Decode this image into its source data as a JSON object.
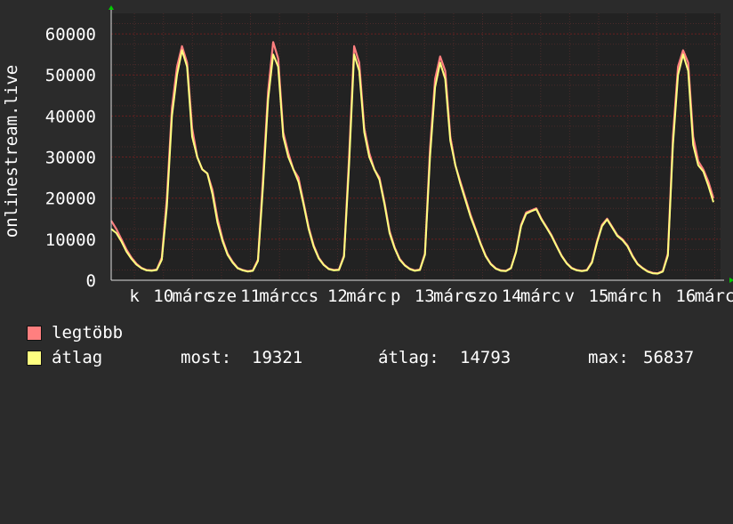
{
  "chart_data": {
    "type": "area",
    "ylabel": "onlinestream.live",
    "y_ticks": [
      "0",
      "10000",
      "20000",
      "30000",
      "40000",
      "50000",
      "60000"
    ],
    "ylim": [
      0,
      65000
    ],
    "x_tick_labels": [
      "k",
      "10",
      "márc",
      "sze",
      "11",
      "márc",
      "cs",
      "12",
      "márc",
      "p",
      "13",
      "márc",
      "szo",
      "14",
      "márc",
      "v",
      "15",
      "márc",
      "h",
      "16",
      "márc"
    ],
    "grid": true,
    "series": [
      {
        "name": "legtöbb",
        "color": "#ff7f7f",
        "values": [
          14500,
          12500,
          10000,
          7500,
          5500,
          4000,
          3000,
          2500,
          2400,
          2600,
          5500,
          20000,
          42000,
          52000,
          57000,
          53000,
          37000,
          30000,
          27000,
          26000,
          22000,
          15000,
          10000,
          6500,
          4500,
          3000,
          2500,
          2200,
          2400,
          5000,
          25000,
          46000,
          58000,
          54000,
          36000,
          31000,
          27000,
          25000,
          19000,
          13000,
          8500,
          5500,
          3800,
          2800,
          2500,
          2600,
          6000,
          30000,
          57000,
          53000,
          37000,
          31000,
          27000,
          25000,
          19000,
          12000,
          8000,
          5200,
          3700,
          2800,
          2400,
          2600,
          6500,
          32000,
          49000,
          54500,
          51000,
          35000,
          28000,
          24000,
          20000,
          16000,
          12500,
          9000,
          6000,
          4000,
          2900,
          2400,
          2300,
          3000,
          7000,
          13500,
          16500,
          17000,
          17500,
          15000,
          13000,
          11000,
          8500,
          6000,
          4200,
          3000,
          2500,
          2300,
          2500,
          4500,
          9500,
          13500,
          15000,
          13000,
          11000,
          10000,
          8500,
          6000,
          4000,
          3000,
          2200,
          1800,
          1700,
          2200,
          6500,
          35000,
          52000,
          56000,
          53000,
          35000,
          29000,
          27000,
          24000,
          20000
        ]
      },
      {
        "name": "átlag",
        "color": "#ffff80",
        "values": [
          12500,
          11500,
          9500,
          7000,
          5200,
          3800,
          2900,
          2400,
          2300,
          2500,
          5000,
          18000,
          40000,
          50000,
          56000,
          52000,
          35000,
          30000,
          27000,
          26000,
          21000,
          14000,
          9500,
          6200,
          4300,
          2900,
          2400,
          2100,
          2300,
          4700,
          23000,
          44000,
          55000,
          52000,
          35000,
          30000,
          27000,
          24000,
          18500,
          12500,
          8200,
          5300,
          3700,
          2700,
          2400,
          2500,
          5700,
          28000,
          55000,
          51000,
          36000,
          30000,
          27000,
          24500,
          18500,
          11500,
          7800,
          5000,
          3600,
          2700,
          2300,
          2500,
          6200,
          30000,
          47000,
          53000,
          49000,
          34000,
          28000,
          23500,
          19500,
          15500,
          12200,
          8800,
          5800,
          3900,
          2800,
          2300,
          2200,
          2900,
          6800,
          13200,
          16200,
          16800,
          17300,
          14800,
          12800,
          10800,
          8300,
          5900,
          4100,
          2900,
          2400,
          2200,
          2400,
          4300,
          9200,
          13200,
          14800,
          12800,
          10800,
          9800,
          8300,
          5800,
          3900,
          2900,
          2100,
          1700,
          1600,
          2100,
          6000,
          33000,
          50000,
          55000,
          51000,
          33000,
          28000,
          26500,
          23000,
          19000
        ]
      }
    ]
  },
  "legend": {
    "items": [
      {
        "label": "legtöbb",
        "color": "#ff7f7f"
      },
      {
        "label": "átlag",
        "color": "#ffff80"
      }
    ],
    "stats": {
      "most_label": "most:",
      "most_value": "19321",
      "atlag_label": "átlag:",
      "atlag_value": "14793",
      "max_label": "max:",
      "max_value": "56837"
    }
  },
  "colors": {
    "background": "#2b2b2b",
    "plot_background": "#222222",
    "grid_major": "#6a1f1f",
    "grid_minor": "#4a2a2a",
    "axis_arrow": "#00cc00"
  }
}
